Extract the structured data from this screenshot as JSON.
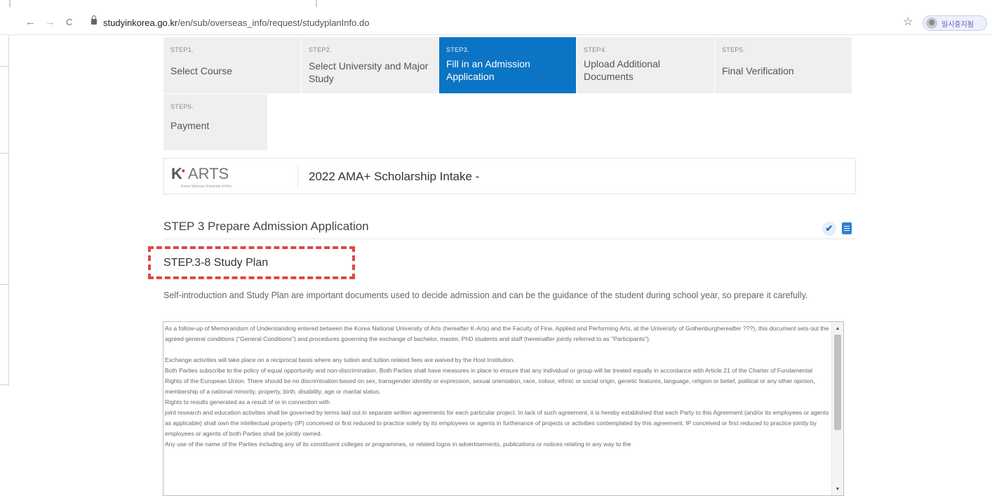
{
  "browser": {
    "back": "←",
    "forward": "→",
    "reload": "C",
    "url_host": "studyinkorea.go.kr",
    "url_path": "/en/sub/overseas_info/request/studyplanInfo.do",
    "star": "☆",
    "profile_label": "일시중지됨"
  },
  "steps": [
    {
      "num": "STEP1.",
      "title": "Select Course"
    },
    {
      "num": "STEP2.",
      "title": "Select University and Major Study"
    },
    {
      "num": "STEP3.",
      "title": "Fill in an Admission Application"
    },
    {
      "num": "STEP4.",
      "title": "Upload Additional Documents"
    },
    {
      "num": "STEP5.",
      "title": "Final Verification"
    },
    {
      "num": "STEP6.",
      "title": "Payment"
    }
  ],
  "active_step_index": 2,
  "school": {
    "logo_mark": "K",
    "logo_dot": "•",
    "logo_text": "ARTS",
    "logo_sub": "Korea National University of Arts",
    "intake_name": "2022 AMA+ Scholarship Intake -"
  },
  "section_title": "STEP 3 Prepare Admission Application",
  "sub_title": "STEP.3-8 Study Plan",
  "intro_text": "Self-introduction and Study Plan are important documents used to decide admission and can be the guidance of the student during school year, so prepare it carefully.",
  "textarea": {
    "p1": "As a follow-up of Memorandum of Understanding entered between the Korea National University of Arts (hereafter K-Arts) and the Faculty of Fine, Applied and Performing Arts, at the University of Gothenburghereafter ???), this document sets out the agreed general conditions (\"General Conditions\") and procedures governing the exchange of bachelor, master, PhD students and staff (hereinafter jointly referred to as \"Participants\").",
    "p2": "Exchange activities will take place on a reciprocal basis where any tuition and tuition related fees are waived by the Host Institution.",
    "p3": "Both Parties subscribe to the policy of equal opportunity and non-discrimination. Both Parties shall have measures in place to ensure that any individual or group will be treated equally in accordance with Article 21 of the Charter of Fundamental Rights of the European Union. There should be no discrimination based on sex, transgender identity or expression, sexual orientation, race, colour, ethnic or social origin, genetic features, language, religion or belief, political or any other opinion, membership of a national minority, property, birth, disability, age or marital status.",
    "p4": "Rights to results generated as a result of or in connection with",
    "p5": " joint research and education activities shall be governed by terms laid out in separate written agreements for each particular project. In lack of such agreement, it is hereby established that each Party to this Agreement (and/or its employees or agents as applicable) shall own the intellectual property (IP) conceived or first reduced to practice solely by its employees or agents in furtherance of projects or activities contemplated by this agreement. IP conceived or first reduced to practice jointly by employees or agents of both Parties shall be jointly owned.",
    "p6": "Any use of the name of the Parties including any of its constituent colleges or programmes, or related logos in advertisements, publications or notices relating in any way to the"
  },
  "icons": {
    "check": "✔",
    "scroll_up": "▲",
    "scroll_down": "▼"
  }
}
